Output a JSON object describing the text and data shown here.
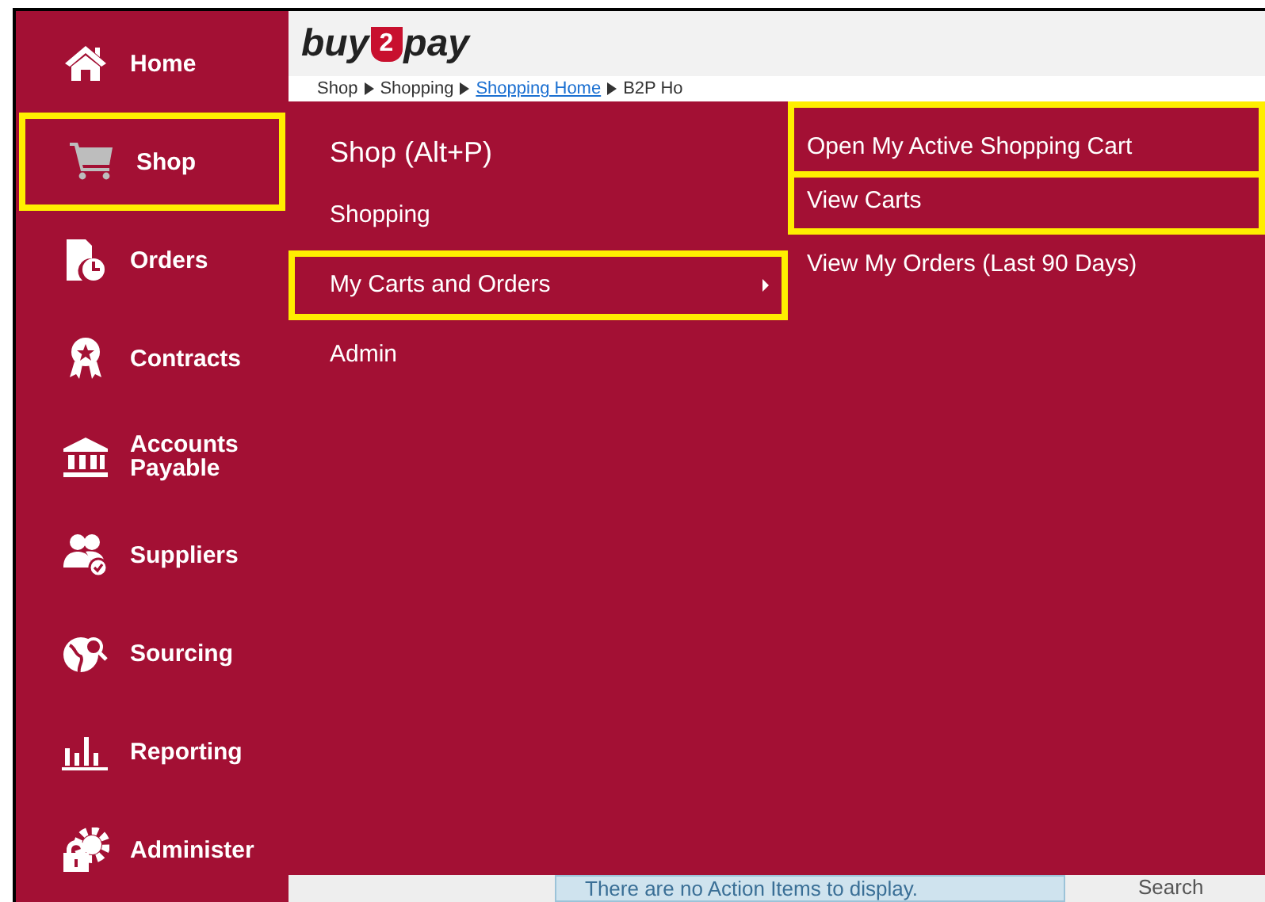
{
  "logo": {
    "before": "buy",
    "badge": "2",
    "after": "pay"
  },
  "breadcrumb": [
    {
      "label": "Shop",
      "link": false
    },
    {
      "label": "Shopping",
      "link": false
    },
    {
      "label": "Shopping Home",
      "link": true
    },
    {
      "label": "B2P Ho",
      "link": false
    }
  ],
  "sidebar": {
    "items": [
      {
        "label": "Home",
        "highlighted": false
      },
      {
        "label": "Shop",
        "highlighted": true
      },
      {
        "label": "Orders",
        "highlighted": false
      },
      {
        "label": "Contracts",
        "highlighted": false
      },
      {
        "label": "Accounts Payable",
        "highlighted": false
      },
      {
        "label": "Suppliers",
        "highlighted": false
      },
      {
        "label": "Sourcing",
        "highlighted": false
      },
      {
        "label": "Reporting",
        "highlighted": false
      },
      {
        "label": "Administer",
        "highlighted": false
      }
    ]
  },
  "menu": {
    "title": "Shop (Alt+P)",
    "items": [
      {
        "label": "Shopping",
        "highlighted": false,
        "submenu": false
      },
      {
        "label": "My Carts and Orders",
        "highlighted": true,
        "submenu": true
      },
      {
        "label": "Admin",
        "highlighted": false,
        "submenu": false
      }
    ],
    "submenu": [
      {
        "label": "Open My Active Shopping Cart",
        "highlighted": true
      },
      {
        "label": "View Carts",
        "highlighted": true
      },
      {
        "label": "View My Orders (Last 90 Days)",
        "highlighted": false
      }
    ]
  },
  "action_items": {
    "message": "There are no Action Items to display."
  },
  "search_label": "Search"
}
